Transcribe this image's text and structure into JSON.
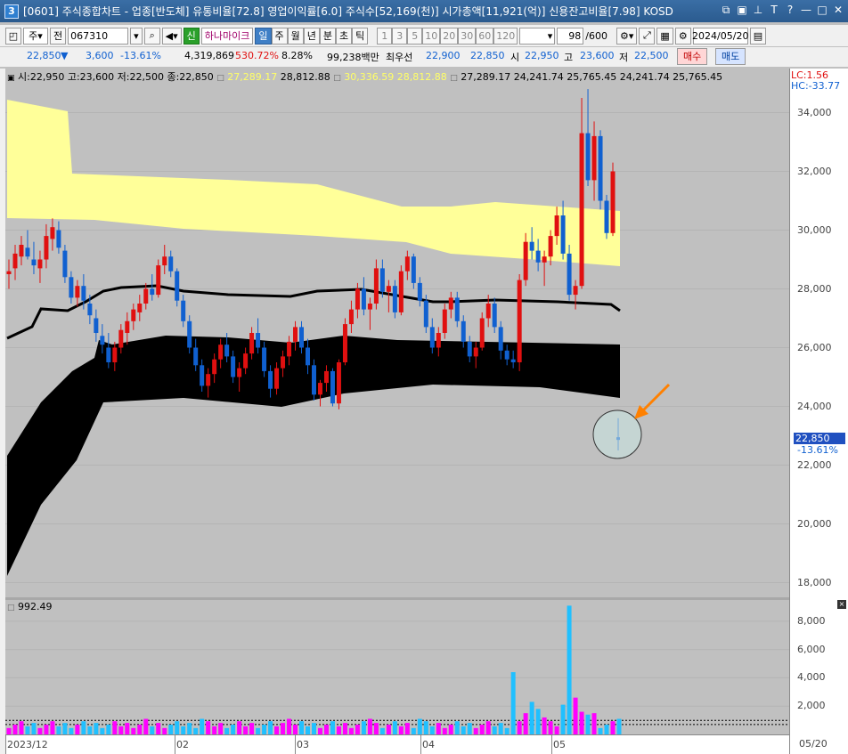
{
  "window": {
    "icon_label": "3",
    "title": "[0601] 주식종합차트 - 업종[반도체] 유통비율[72.8] 영업이익률[6.0] 주식수[52,169(천)] 시가총액[11,921(억)] 신용잔고비율[7.98] KOSD"
  },
  "toolbar": {
    "period_select": "주",
    "prefix_label": "전",
    "code_value": "067310",
    "new_badge": "신",
    "broker_label": "하나마이크",
    "tabs": [
      "일",
      "주",
      "월",
      "년",
      "분",
      "초",
      "틱"
    ],
    "tab_selected": "일",
    "intervals": [
      "1",
      "3",
      "5",
      "10",
      "20",
      "30",
      "60",
      "120"
    ],
    "count_value": "98",
    "count_max": "/600",
    "date_value": "2024/05/20"
  },
  "quote": {
    "price": "22,850",
    "down_mark": "▼",
    "change": "3,600",
    "change_pct": "-13.61%",
    "volume": "4,319,869",
    "volume_ratio": "530.72%",
    "turnover": "8.28%",
    "amount": "99,238백만",
    "best_ask_label": "최우선",
    "best_ask": "22,900",
    "best_bid": "22,850",
    "open_label": "시",
    "open": "22,950",
    "high_label": "고",
    "high": "23,600",
    "low_label": "저",
    "low": "22,500",
    "buy_label": "매수",
    "sell_label": "매도"
  },
  "legend": {
    "ohlc": "시:22,950 고:23,600 저:22,500 종:22,850",
    "ma1": "27,289.17",
    "ma2": "28,812.88",
    "ma3": "30,336.59",
    "ma4": "28,812.88",
    "rest": "27,289.17 24,241.74 25,765.45 24,241.74 25,765.45"
  },
  "axis": {
    "lc": "LC:1.56",
    "hc": "HC:-33.77",
    "price_ticks": [
      "34,000",
      "32,000",
      "30,000",
      "28,000",
      "26,000",
      "24,000",
      "22,000",
      "20,000",
      "18,000"
    ],
    "current_price": "22,850",
    "current_pct": "-13.61%",
    "vol_ticks": [
      "8,000",
      "6,000",
      "4,000",
      "2,000"
    ],
    "date_end": "05/20"
  },
  "volume": {
    "legend": "992.49"
  },
  "xaxis": {
    "labels": [
      "2023/12",
      "02",
      "03",
      "04",
      "05"
    ]
  },
  "colors": {
    "up": "#e01010",
    "down": "#1060d0",
    "cloud_yellow": "#ffff99",
    "cloud_black": "#000000",
    "vol_up": "#ff00ff",
    "vol_down": "#20c0ff",
    "marker_arrow": "#ff8000"
  },
  "chart_data": {
    "type": "candlestick",
    "ylim": [
      17500,
      35500
    ],
    "candles": [
      [
        28500,
        29000,
        28000,
        28600
      ],
      [
        28700,
        29500,
        28300,
        29200
      ],
      [
        29100,
        29800,
        28800,
        29500
      ],
      [
        29400,
        30000,
        29000,
        29100
      ],
      [
        29000,
        29600,
        28500,
        28800
      ],
      [
        28700,
        29300,
        28200,
        29000
      ],
      [
        29000,
        30200,
        28700,
        29800
      ],
      [
        29700,
        30400,
        29300,
        30100
      ],
      [
        30000,
        30300,
        29200,
        29400
      ],
      [
        29300,
        29500,
        28200,
        28400
      ],
      [
        28400,
        28600,
        27500,
        27700
      ],
      [
        27700,
        28300,
        27400,
        28100
      ],
      [
        28100,
        28500,
        27300,
        27600
      ],
      [
        27500,
        27800,
        26800,
        27100
      ],
      [
        27000,
        27300,
        26200,
        26500
      ],
      [
        26400,
        26800,
        25800,
        26100
      ],
      [
        26000,
        26500,
        25300,
        25500
      ],
      [
        25500,
        26200,
        25200,
        26000
      ],
      [
        26000,
        26800,
        25800,
        26600
      ],
      [
        26500,
        27200,
        26100,
        26900
      ],
      [
        26900,
        27500,
        26600,
        27300
      ],
      [
        27200,
        27800,
        26900,
        27500
      ],
      [
        27500,
        28200,
        27300,
        28000
      ],
      [
        28000,
        28500,
        27600,
        27800
      ],
      [
        27800,
        29000,
        27700,
        28800
      ],
      [
        28800,
        29500,
        28500,
        29100
      ],
      [
        29100,
        29300,
        28400,
        28600
      ],
      [
        28600,
        28700,
        27400,
        27600
      ],
      [
        27600,
        27800,
        26700,
        26900
      ],
      [
        26900,
        27100,
        25800,
        26000
      ],
      [
        26000,
        26300,
        25200,
        25400
      ],
      [
        25400,
        25600,
        24500,
        24700
      ],
      [
        24700,
        25300,
        24300,
        25100
      ],
      [
        25100,
        25800,
        24800,
        25600
      ],
      [
        25600,
        26300,
        25300,
        26100
      ],
      [
        26100,
        26500,
        25500,
        25700
      ],
      [
        25700,
        25900,
        24800,
        25000
      ],
      [
        25000,
        25500,
        24500,
        25300
      ],
      [
        25300,
        26000,
        25100,
        25800
      ],
      [
        25800,
        26700,
        25600,
        26500
      ],
      [
        26500,
        27000,
        25800,
        26000
      ],
      [
        26000,
        26200,
        25000,
        25200
      ],
      [
        25200,
        25400,
        24300,
        24600
      ],
      [
        24600,
        25500,
        24400,
        25300
      ],
      [
        25300,
        25900,
        25000,
        25700
      ],
      [
        25700,
        26400,
        25400,
        26200
      ],
      [
        26200,
        26900,
        25900,
        26700
      ],
      [
        26700,
        26900,
        25800,
        26000
      ],
      [
        26000,
        26300,
        25100,
        25400
      ],
      [
        25400,
        25600,
        24200,
        24400
      ],
      [
        24400,
        24900,
        24000,
        24800
      ],
      [
        24800,
        25400,
        24500,
        25200
      ],
      [
        25200,
        25300,
        24000,
        24100
      ],
      [
        24100,
        25600,
        23900,
        25500
      ],
      [
        25500,
        27000,
        25400,
        26800
      ],
      [
        26800,
        27600,
        26500,
        27300
      ],
      [
        27300,
        28200,
        27000,
        28000
      ],
      [
        28000,
        28400,
        27100,
        27300
      ],
      [
        27300,
        27700,
        26600,
        27500
      ],
      [
        27500,
        29000,
        27300,
        28700
      ],
      [
        28700,
        29000,
        27700,
        27900
      ],
      [
        27900,
        28300,
        27200,
        28100
      ],
      [
        28100,
        28300,
        27000,
        27200
      ],
      [
        27200,
        28800,
        27100,
        28600
      ],
      [
        28600,
        29300,
        28300,
        29100
      ],
      [
        29100,
        29200,
        28000,
        28200
      ],
      [
        28200,
        28400,
        27400,
        27600
      ],
      [
        27600,
        27800,
        26500,
        26700
      ],
      [
        26700,
        27000,
        25800,
        26000
      ],
      [
        26000,
        26700,
        25700,
        26500
      ],
      [
        26500,
        27500,
        26300,
        27300
      ],
      [
        27300,
        27900,
        27000,
        27700
      ],
      [
        27700,
        27900,
        26700,
        26900
      ],
      [
        26900,
        27100,
        26000,
        26200
      ],
      [
        26200,
        26400,
        25500,
        25700
      ],
      [
        25700,
        26200,
        25300,
        26000
      ],
      [
        26000,
        27200,
        25900,
        27000
      ],
      [
        27000,
        27800,
        26700,
        27500
      ],
      [
        27500,
        27700,
        26500,
        26700
      ],
      [
        26700,
        26900,
        25600,
        25900
      ],
      [
        25900,
        26100,
        25400,
        25600
      ],
      [
        25600,
        25900,
        25300,
        25500
      ],
      [
        25500,
        28500,
        25200,
        28300
      ],
      [
        28300,
        29900,
        28100,
        29600
      ],
      [
        29600,
        30100,
        29000,
        29300
      ],
      [
        29300,
        29700,
        28600,
        28900
      ],
      [
        28900,
        29300,
        28100,
        29100
      ],
      [
        29100,
        30000,
        28800,
        29800
      ],
      [
        29800,
        30800,
        29500,
        30500
      ],
      [
        30500,
        31000,
        29000,
        29200
      ],
      [
        29200,
        29500,
        27600,
        27800
      ],
      [
        27800,
        28300,
        27300,
        28100
      ],
      [
        28100,
        34500,
        28000,
        33300
      ],
      [
        33300,
        34800,
        31500,
        31700
      ],
      [
        31700,
        33700,
        31000,
        33200
      ],
      [
        33200,
        33400,
        30700,
        31000
      ],
      [
        31000,
        31200,
        29700,
        29900
      ],
      [
        29900,
        32300,
        29800,
        32000
      ]
    ]
  }
}
